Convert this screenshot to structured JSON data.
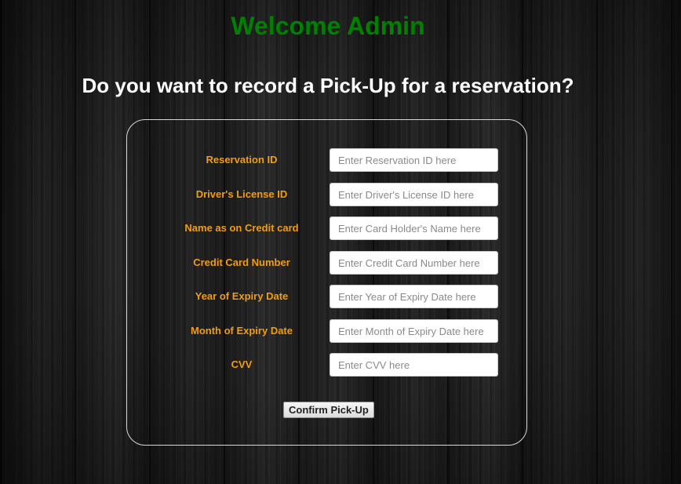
{
  "header": {
    "welcome": "Welcome Admin",
    "question": "Do you want to record a Pick-Up for a reservation?"
  },
  "form": {
    "fields": [
      {
        "label": "Reservation ID",
        "placeholder": "Enter Reservation ID here",
        "value": ""
      },
      {
        "label": "Driver's License ID",
        "placeholder": "Enter Driver's License ID here",
        "value": ""
      },
      {
        "label": "Name as on Credit card",
        "placeholder": "Enter Card Holder's Name here",
        "value": ""
      },
      {
        "label": "Credit Card Number",
        "placeholder": "Enter Credit Card Number here",
        "value": ""
      },
      {
        "label": "Year of Expiry Date",
        "placeholder": "Enter Year of Expiry Date here",
        "value": ""
      },
      {
        "label": "Month of Expiry Date",
        "placeholder": "Enter Month of Expiry Date here",
        "value": ""
      },
      {
        "label": "CVV",
        "placeholder": "Enter CVV here",
        "value": ""
      }
    ],
    "submit_label": "Confirm Pick-Up"
  },
  "colors": {
    "welcome": "#008000",
    "label": "#f39c12",
    "question": "#ffffff"
  }
}
